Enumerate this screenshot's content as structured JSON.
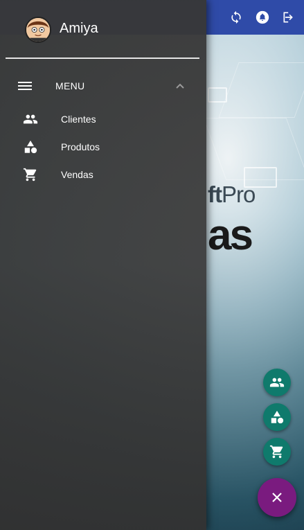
{
  "user": {
    "name": "Amiya"
  },
  "menu": {
    "title": "MENU",
    "items": [
      {
        "label": "Clientes",
        "icon": "people-icon"
      },
      {
        "label": "Produtos",
        "icon": "shapes-icon"
      },
      {
        "label": "Vendas",
        "icon": "cart-icon"
      }
    ]
  },
  "background": {
    "brand_small_a": "ft",
    "brand_small_b": "Pro",
    "brand_big": "as"
  },
  "topbar": {
    "icons": [
      "sync-icon",
      "notification-icon",
      "logout-icon"
    ],
    "color": "#2f4ba8"
  },
  "fab": {
    "mini_color": "#0f7a6c",
    "main_color": "#7a1b7f",
    "mini": [
      "people-icon",
      "shapes-icon",
      "cart-icon"
    ],
    "main_icon": "close-icon"
  }
}
